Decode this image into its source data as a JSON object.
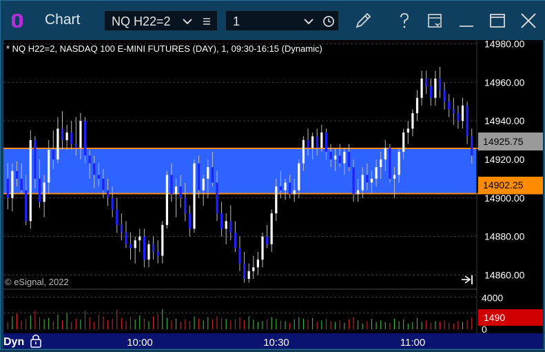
{
  "window": {
    "title": "Chart",
    "symbol": "NQ H22=2",
    "interval": "1"
  },
  "chart": {
    "description": "* NQ H22=2, NASDAQ 100 E-MINI FUTURES (DAY), 1, 09:30-16:15 (Dynamic)",
    "copyright": "© eSignal, 2022",
    "mode_label": "Dyn",
    "price_tags": {
      "upper": "14925.75",
      "lower": "14902.25",
      "volume": "1490"
    },
    "colors": {
      "band": "#2f63ff",
      "band_border": "#ff8c1a",
      "up_candle": "#ffffff",
      "down_candle": "#1f22ff",
      "volume_up": "#3fd13f",
      "volume_down": "#e02b2b",
      "tag_gray": "#9a9a9a",
      "tag_orange": "#ff8c00",
      "tag_red": "#d10000"
    }
  },
  "chart_data": {
    "type": "candlestick",
    "price_axis": {
      "ylim": [
        14853,
        14982
      ],
      "ticks": [
        "14980.00",
        "14960.00",
        "14940.00",
        "14920.00",
        "14900.00",
        "14880.00",
        "14860.00"
      ]
    },
    "volume_axis": {
      "ylim": [
        0,
        4200
      ],
      "ticks": [
        "4000",
        "0"
      ]
    },
    "time_axis": {
      "ticks": [
        "10:00",
        "10:30",
        "11:00"
      ]
    },
    "band": {
      "upper": 14925.75,
      "lower": 14902.25
    },
    "candles_ohlc": [
      [
        14910,
        14918,
        14894,
        14900
      ],
      [
        14900,
        14918,
        14893,
        14914
      ],
      [
        14914,
        14919,
        14906,
        14910
      ],
      [
        14910,
        14918,
        14902,
        14904
      ],
      [
        14904,
        14912,
        14886,
        14888
      ],
      [
        14888,
        14935,
        14884,
        14930
      ],
      [
        14930,
        14932,
        14905,
        14910
      ],
      [
        14910,
        14920,
        14895,
        14898
      ],
      [
        14898,
        14912,
        14890,
        14908
      ],
      [
        14908,
        14930,
        14902,
        14925
      ],
      [
        14925,
        14935,
        14915,
        14920
      ],
      [
        14920,
        14942,
        14918,
        14936
      ],
      [
        14936,
        14945,
        14925,
        14930
      ],
      [
        14930,
        14938,
        14925,
        14934
      ],
      [
        14934,
        14940,
        14925,
        14928
      ],
      [
        14928,
        14942,
        14922,
        14926
      ],
      [
        14926,
        14944,
        14920,
        14940
      ],
      [
        14940,
        14942,
        14918,
        14922
      ],
      [
        14922,
        14925,
        14910,
        14918
      ],
      [
        14918,
        14922,
        14905,
        14912
      ],
      [
        14912,
        14918,
        14906,
        14910
      ],
      [
        14910,
        14915,
        14900,
        14904
      ],
      [
        14904,
        14910,
        14896,
        14900
      ],
      [
        14900,
        14906,
        14890,
        14894
      ],
      [
        14894,
        14900,
        14882,
        14886
      ],
      [
        14886,
        14892,
        14878,
        14882
      ],
      [
        14882,
        14888,
        14874,
        14876
      ],
      [
        14876,
        14882,
        14868,
        14874
      ],
      [
        14874,
        14880,
        14866,
        14878
      ],
      [
        14878,
        14884,
        14872,
        14880
      ],
      [
        14880,
        14884,
        14864,
        14868
      ],
      [
        14868,
        14878,
        14864,
        14876
      ],
      [
        14876,
        14880,
        14868,
        14872
      ],
      [
        14872,
        14878,
        14866,
        14870
      ],
      [
        14870,
        14888,
        14866,
        14886
      ],
      [
        14886,
        14914,
        14884,
        14912
      ],
      [
        14912,
        14918,
        14898,
        14902
      ],
      [
        14902,
        14910,
        14890,
        14906
      ],
      [
        14906,
        14912,
        14895,
        14900
      ],
      [
        14900,
        14908,
        14888,
        14892
      ],
      [
        14892,
        14896,
        14880,
        14884
      ],
      [
        14884,
        14920,
        14882,
        14918
      ],
      [
        14918,
        14922,
        14900,
        14904
      ],
      [
        14904,
        14912,
        14896,
        14910
      ],
      [
        14910,
        14920,
        14900,
        14916
      ],
      [
        14916,
        14924,
        14906,
        14908
      ],
      [
        14908,
        14914,
        14888,
        14892
      ],
      [
        14892,
        14898,
        14880,
        14884
      ],
      [
        14884,
        14892,
        14876,
        14888
      ],
      [
        14888,
        14896,
        14878,
        14882
      ],
      [
        14882,
        14888,
        14872,
        14874
      ],
      [
        14874,
        14880,
        14862,
        14866
      ],
      [
        14866,
        14872,
        14856,
        14858
      ],
      [
        14858,
        14866,
        14856,
        14862
      ],
      [
        14862,
        14870,
        14858,
        14864
      ],
      [
        14864,
        14872,
        14860,
        14868
      ],
      [
        14868,
        14882,
        14864,
        14880
      ],
      [
        14880,
        14886,
        14874,
        14876
      ],
      [
        14876,
        14894,
        14872,
        14892
      ],
      [
        14892,
        14910,
        14888,
        14906
      ],
      [
        14906,
        14914,
        14900,
        14904
      ],
      [
        14904,
        14910,
        14899,
        14908
      ],
      [
        14908,
        14912,
        14900,
        14902
      ],
      [
        14902,
        14910,
        14898,
        14904
      ],
      [
        14904,
        14920,
        14900,
        14918
      ],
      [
        14918,
        14932,
        14914,
        14930
      ],
      [
        14930,
        14936,
        14922,
        14926
      ],
      [
        14926,
        14934,
        14920,
        14932
      ],
      [
        14932,
        14936,
        14922,
        14926
      ],
      [
        14926,
        14938,
        14924,
        14934
      ],
      [
        14934,
        14936,
        14920,
        14924
      ],
      [
        14924,
        14928,
        14916,
        14920
      ],
      [
        14920,
        14926,
        14914,
        14922
      ],
      [
        14922,
        14928,
        14916,
        14918
      ],
      [
        14918,
        14926,
        14912,
        14924
      ],
      [
        14924,
        14928,
        14914,
        14916
      ],
      [
        14916,
        14920,
        14898,
        14902
      ],
      [
        14902,
        14910,
        14898,
        14904
      ],
      [
        14904,
        14916,
        14900,
        14912
      ],
      [
        14912,
        14918,
        14904,
        14908
      ],
      [
        14908,
        14914,
        14902,
        14910
      ],
      [
        14910,
        14920,
        14906,
        14916
      ],
      [
        14916,
        14924,
        14910,
        14920
      ],
      [
        14920,
        14930,
        14914,
        14926
      ],
      [
        14926,
        14928,
        14908,
        14910
      ],
      [
        14910,
        14916,
        14900,
        14912
      ],
      [
        14912,
        14926,
        14908,
        14924
      ],
      [
        14924,
        14936,
        14920,
        14934
      ],
      [
        14934,
        14940,
        14928,
        14936
      ],
      [
        14936,
        14946,
        14932,
        14944
      ],
      [
        14944,
        14956,
        14940,
        14952
      ],
      [
        14952,
        14966,
        14948,
        14962
      ],
      [
        14962,
        14966,
        14954,
        14958
      ],
      [
        14958,
        14962,
        14948,
        14952
      ],
      [
        14952,
        14966,
        14948,
        14962
      ],
      [
        14962,
        14968,
        14952,
        14956
      ],
      [
        14956,
        14960,
        14946,
        14950
      ],
      [
        14950,
        14954,
        14942,
        14946
      ],
      [
        14946,
        14952,
        14938,
        14944
      ],
      [
        14944,
        14948,
        14936,
        14940
      ],
      [
        14940,
        14952,
        14936,
        14948
      ],
      [
        14948,
        14950,
        14928,
        14932
      ],
      [
        14932,
        14936,
        14918,
        14922
      ]
    ],
    "volume": [
      900,
      1600,
      1900,
      1100,
      1300,
      1700,
      2300,
      1500,
      1200,
      1400,
      1000,
      1800,
      1100,
      2000,
      900,
      1300,
      1200,
      2300,
      1500,
      900,
      1800,
      1600,
      1100,
      1300,
      2400,
      1400,
      1000,
      1500,
      1200,
      1700,
      1300,
      1000,
      1600,
      1900,
      2500,
      1400,
      1100,
      1300,
      900,
      1200,
      1000,
      1600,
      1300,
      1100,
      1500,
      1200,
      1600,
      1400,
      1300,
      1100,
      1200,
      1500,
      1100,
      1600,
      1200,
      900,
      1000,
      1200,
      1500,
      1300,
      1100,
      1000,
      800,
      1200,
      1500,
      1300,
      1200,
      1400,
      900,
      1100,
      1300,
      1000,
      900,
      1100,
      800,
      1200,
      1500,
      1100,
      700,
      1000,
      1300,
      900,
      1100,
      900,
      800,
      1300,
      1000,
      1200,
      700,
      900,
      1400,
      900,
      1100,
      800,
      1000,
      900,
      1100,
      800,
      700,
      1000,
      900,
      1100,
      1490
    ]
  }
}
